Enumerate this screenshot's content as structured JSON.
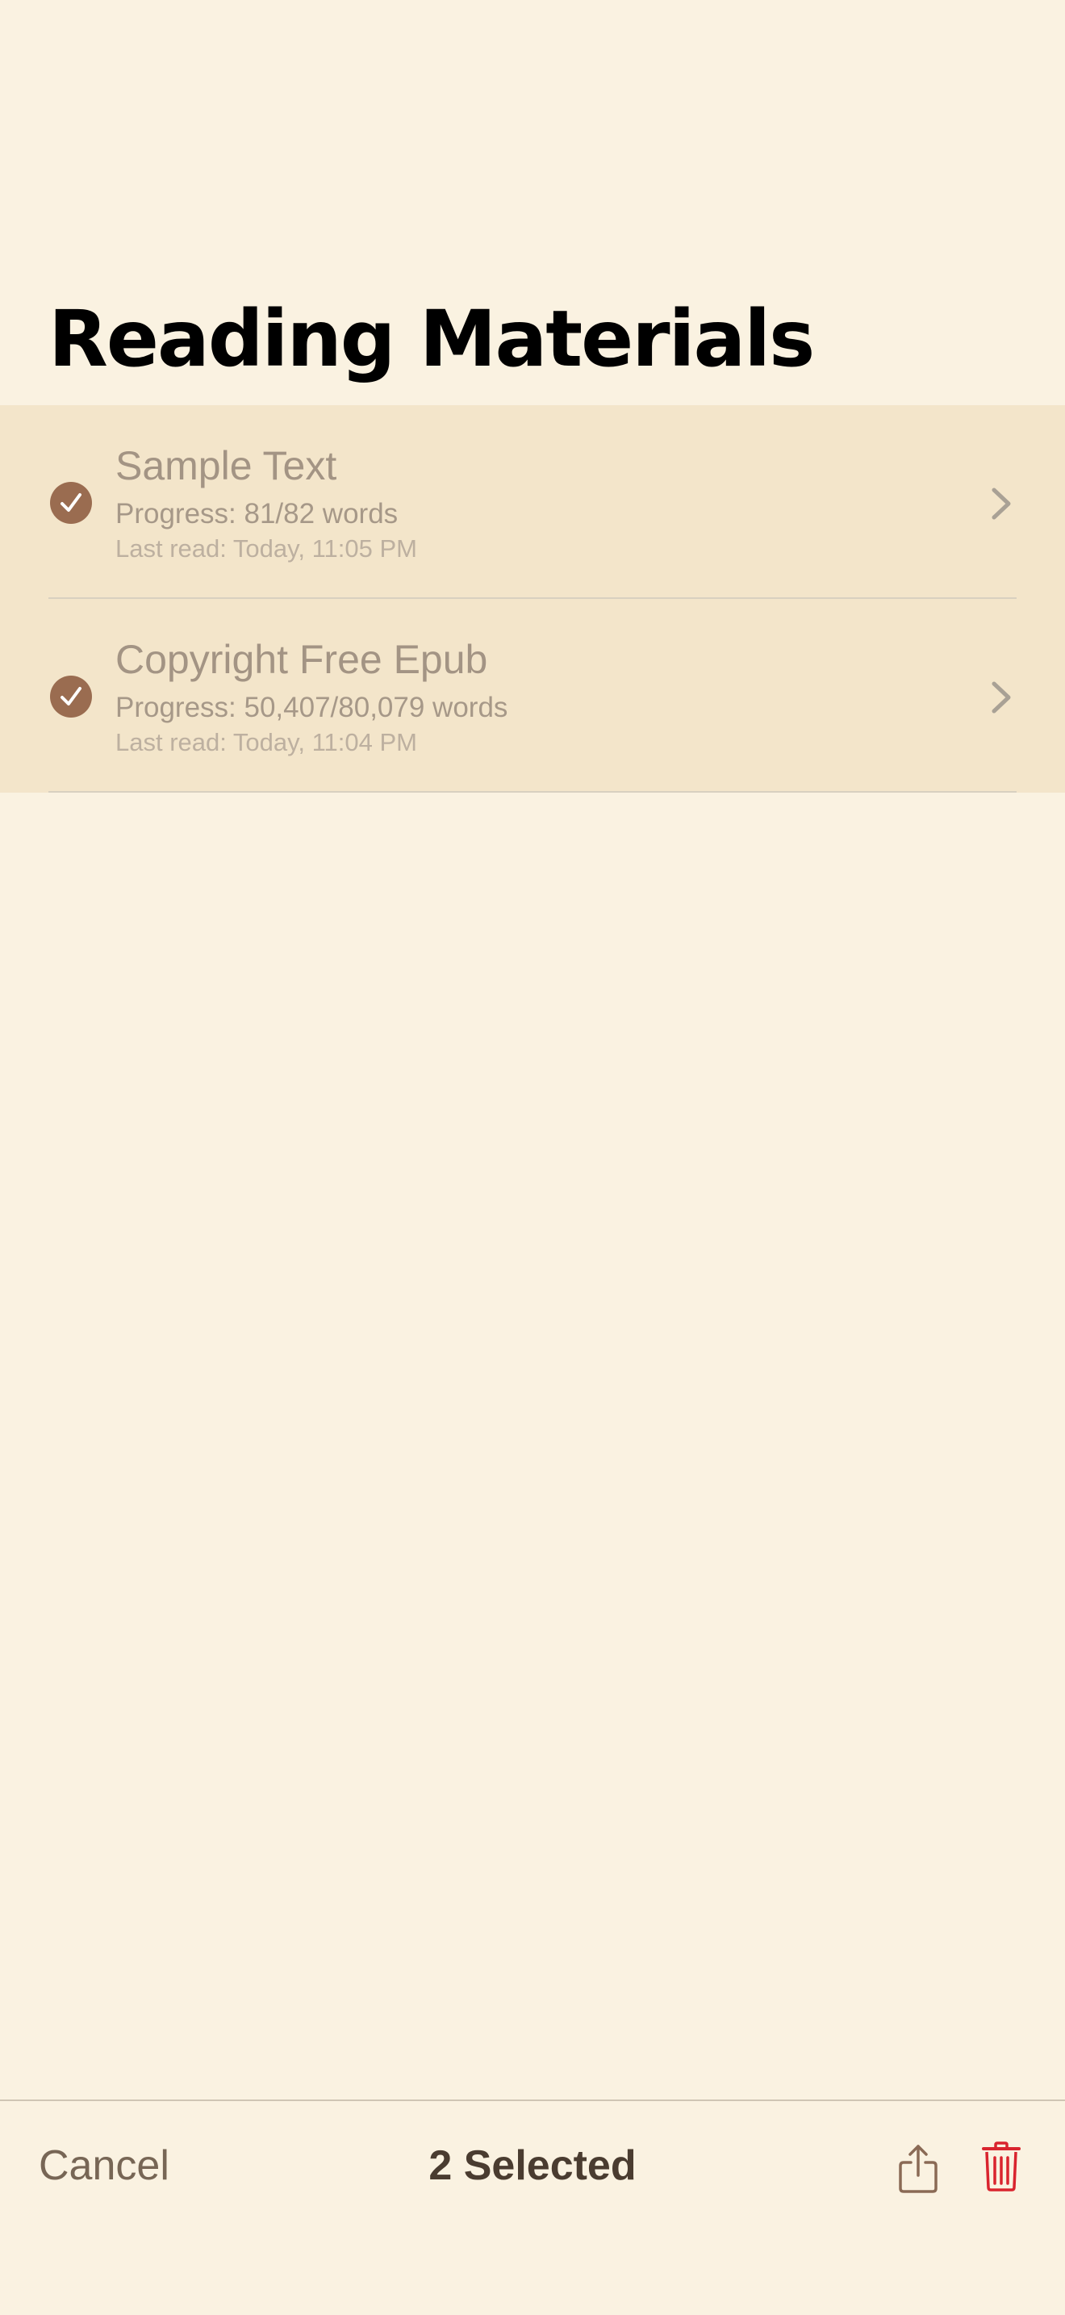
{
  "page": {
    "title": "Reading Materials"
  },
  "materials": [
    {
      "title": "Sample Text",
      "progress": "Progress: 81/82 words",
      "last_read": "Last read: Today, 11:05 PM",
      "selected": true
    },
    {
      "title": "Copyright Free Epub",
      "progress": "Progress: 50,407/80,079 words",
      "last_read": "Last read: Today, 11:04 PM",
      "selected": true
    }
  ],
  "toolbar": {
    "cancel_label": "Cancel",
    "selected_label": "2 Selected",
    "share_icon": "share-icon",
    "trash_icon": "trash-icon"
  },
  "colors": {
    "background": "#faf2e1",
    "selected_row": "#f3e5ca",
    "checkmark_fill": "#9a6c50",
    "delete_red": "#d9242e"
  }
}
